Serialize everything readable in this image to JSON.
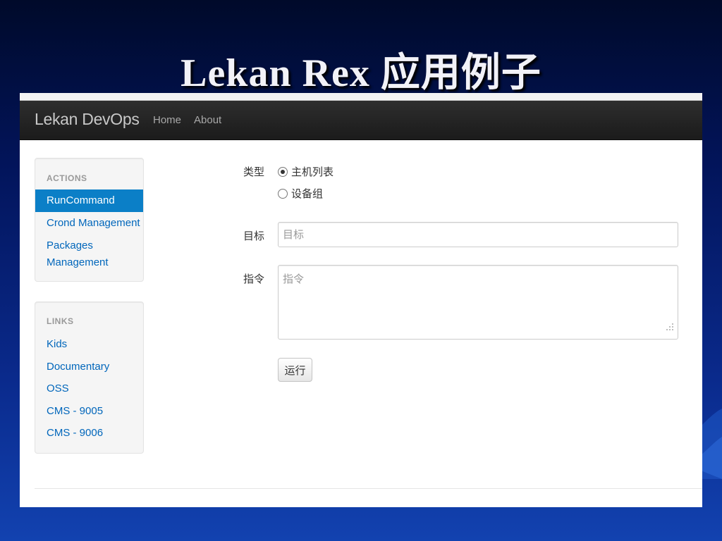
{
  "slide": {
    "title": "Lekan Rex 应用例子"
  },
  "navbar": {
    "brand": "Lekan DevOps",
    "links": [
      "Home",
      "About"
    ]
  },
  "sidebar": {
    "actions": {
      "header": "ACTIONS",
      "items": [
        {
          "label": "RunCommand",
          "active": true
        },
        {
          "label": "Crond Management",
          "active": false
        },
        {
          "label": "Packages\nManagement",
          "active": false
        }
      ]
    },
    "links": {
      "header": "LINKS",
      "items": [
        "Kids",
        "Documentary",
        "OSS",
        "CMS - 9005",
        "CMS - 9006"
      ]
    }
  },
  "form": {
    "type_label": "类型",
    "type_options": [
      {
        "label": "主机列表",
        "checked": true
      },
      {
        "label": "设备组",
        "checked": false
      }
    ],
    "target_label": "目标",
    "target_placeholder": "目标",
    "target_value": "",
    "command_label": "指令",
    "command_placeholder": "指令",
    "command_value": "",
    "run_button": "运行"
  },
  "colors": {
    "active_item": "#0b7fc7",
    "link": "#0066bb",
    "navbar": "#222222"
  }
}
